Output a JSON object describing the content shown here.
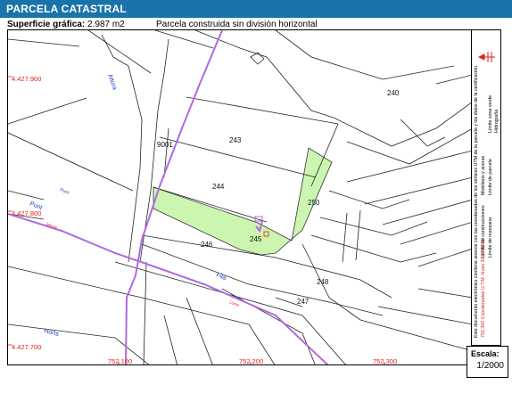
{
  "header": {
    "title": "PARCELA CATASTRAL"
  },
  "info": {
    "surface_label": "Superficie gráfica:",
    "surface_value": "2.987 m2",
    "description": "Parcela construida sin división horizontal"
  },
  "map": {
    "parcels": [
      "240",
      "243",
      "9001",
      "244",
      "250",
      "245",
      "246",
      "248",
      "247"
    ],
    "streets": [
      "Altura",
      "Punt",
      "Fila",
      "Horts"
    ],
    "small_red_labels": [
      "Jarcas",
      "Carre"
    ],
    "y_coords": [
      "4.427.900",
      "4.427.800",
      "4.427.700"
    ],
    "x_coords": [
      "752.100",
      "752.200",
      "752.300"
    ],
    "highlight_color": "#ccf5b0",
    "street_color": "#b06ae0",
    "coord_color": "#e02020"
  },
  "side": {
    "legend_parcel": "Límite de parcela",
    "legend_manzana": "Límite de manzana",
    "legend_const": "Límite de construcciones",
    "legend_hidro": "Hidrografía",
    "legend_mobiliario": "Mobiliario y aceras",
    "legend_zona_verde": "Límite zona verde",
    "coord_note": "752.300 Coordenadas U.T.M. Huso 30 ETRS89",
    "doc_note": "Este documento electrónico contiene anexos con las coordenadas de los vértices UTM de la parcela y los datos de la certificación."
  },
  "scale": {
    "label": "Escala:",
    "value": "1/2000"
  }
}
